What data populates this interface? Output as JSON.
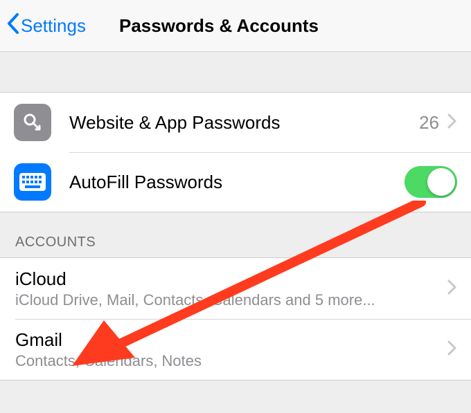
{
  "nav": {
    "back_label": "Settings",
    "title": "Passwords & Accounts"
  },
  "passwords_group": {
    "website_app": {
      "label": "Website & App Passwords",
      "count": "26"
    },
    "autofill": {
      "label": "AutoFill Passwords",
      "enabled": true
    }
  },
  "accounts_section": {
    "header": "ACCOUNTS",
    "items": [
      {
        "title": "iCloud",
        "subtitle": "iCloud Drive, Mail, Contacts, Calendars and 5 more..."
      },
      {
        "title": "Gmail",
        "subtitle": "Contacts, Calendars, Notes"
      }
    ]
  },
  "annotation": {
    "color": "#ff3b1f"
  }
}
